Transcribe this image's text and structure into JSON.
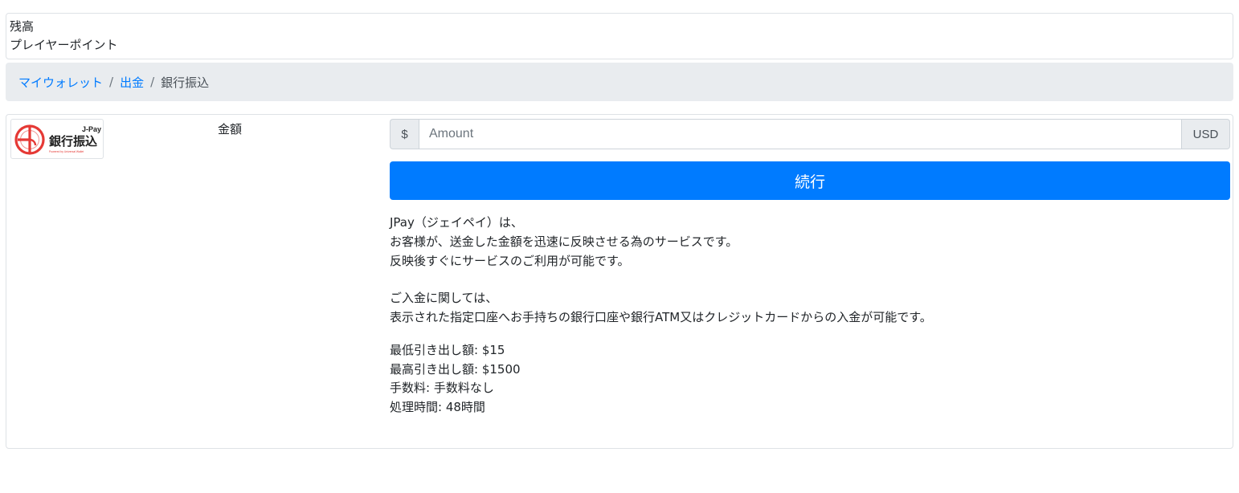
{
  "balance": {
    "label": "残高",
    "points_label": "プレイヤーポイント"
  },
  "breadcrumb": {
    "items": [
      {
        "label": "マイウォレット"
      },
      {
        "label": "出金"
      }
    ],
    "separator": "/",
    "current": "銀行振込"
  },
  "method": {
    "logo": {
      "brand": "J-Pay",
      "text": "銀行振込",
      "tagline": "Powered by Universal Wallet"
    },
    "amount_label": "金額",
    "currency_symbol": "$",
    "amount_placeholder": "Amount",
    "currency_code": "USD",
    "continue_label": "続行",
    "description": [
      "JPay（ジェイペイ）は、",
      "お客様が、送金した金額を迅速に反映させる為のサービスです。",
      "反映後すぐにサービスのご利用が可能です。",
      "ご入金に関しては、",
      "表示された指定口座へお手持ちの銀行口座や銀行ATM又はクレジットカードからの入金が可能です。"
    ],
    "limits": {
      "min_withdrawal": "最低引き出し額: $15",
      "max_withdrawal": "最高引き出し額: $1500",
      "fee": "手数料: 手数料なし",
      "processing_time": "処理時間: 48時間"
    }
  },
  "colors": {
    "primary": "#007bff",
    "logo_red": "#e53935",
    "breadcrumb_bg": "#e9ecef"
  }
}
